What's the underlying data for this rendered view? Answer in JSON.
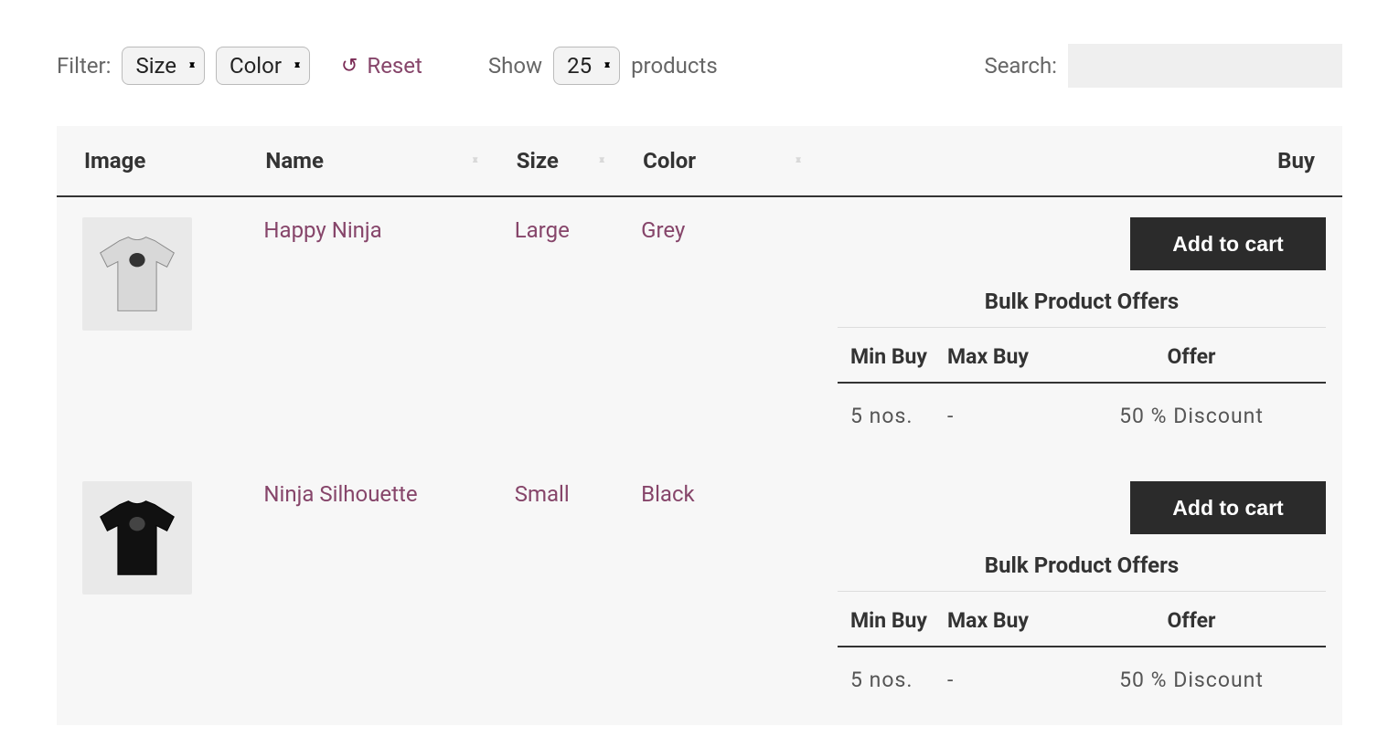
{
  "controls": {
    "filter_label": "Filter:",
    "size_select": "Size",
    "color_select": "Color",
    "reset_label": "Reset",
    "show_label": "Show",
    "show_value": "25",
    "show_suffix": "products",
    "search_label": "Search:",
    "search_value": ""
  },
  "columns": {
    "image": "Image",
    "name": "Name",
    "size": "Size",
    "color": "Color",
    "buy": "Buy"
  },
  "products": [
    {
      "name": "Happy Ninja",
      "size": "Large",
      "color": "Grey",
      "tshirt_fill": "#d8d8d8",
      "add_label": "Add to cart",
      "offers_title": "Bulk Product Offers",
      "offers_cols": {
        "min": "Min Buy",
        "max": "Max Buy",
        "offer": "Offer"
      },
      "offers_rows": [
        {
          "min": "5 nos.",
          "max": "-",
          "offer": "50 % Discount"
        }
      ]
    },
    {
      "name": "Ninja Silhouette",
      "size": "Small",
      "color": "Black",
      "tshirt_fill": "#111111",
      "add_label": "Add to cart",
      "offers_title": "Bulk Product Offers",
      "offers_cols": {
        "min": "Min Buy",
        "max": "Max Buy",
        "offer": "Offer"
      },
      "offers_rows": [
        {
          "min": "5 nos.",
          "max": "-",
          "offer": "50 % Discount"
        }
      ]
    }
  ]
}
